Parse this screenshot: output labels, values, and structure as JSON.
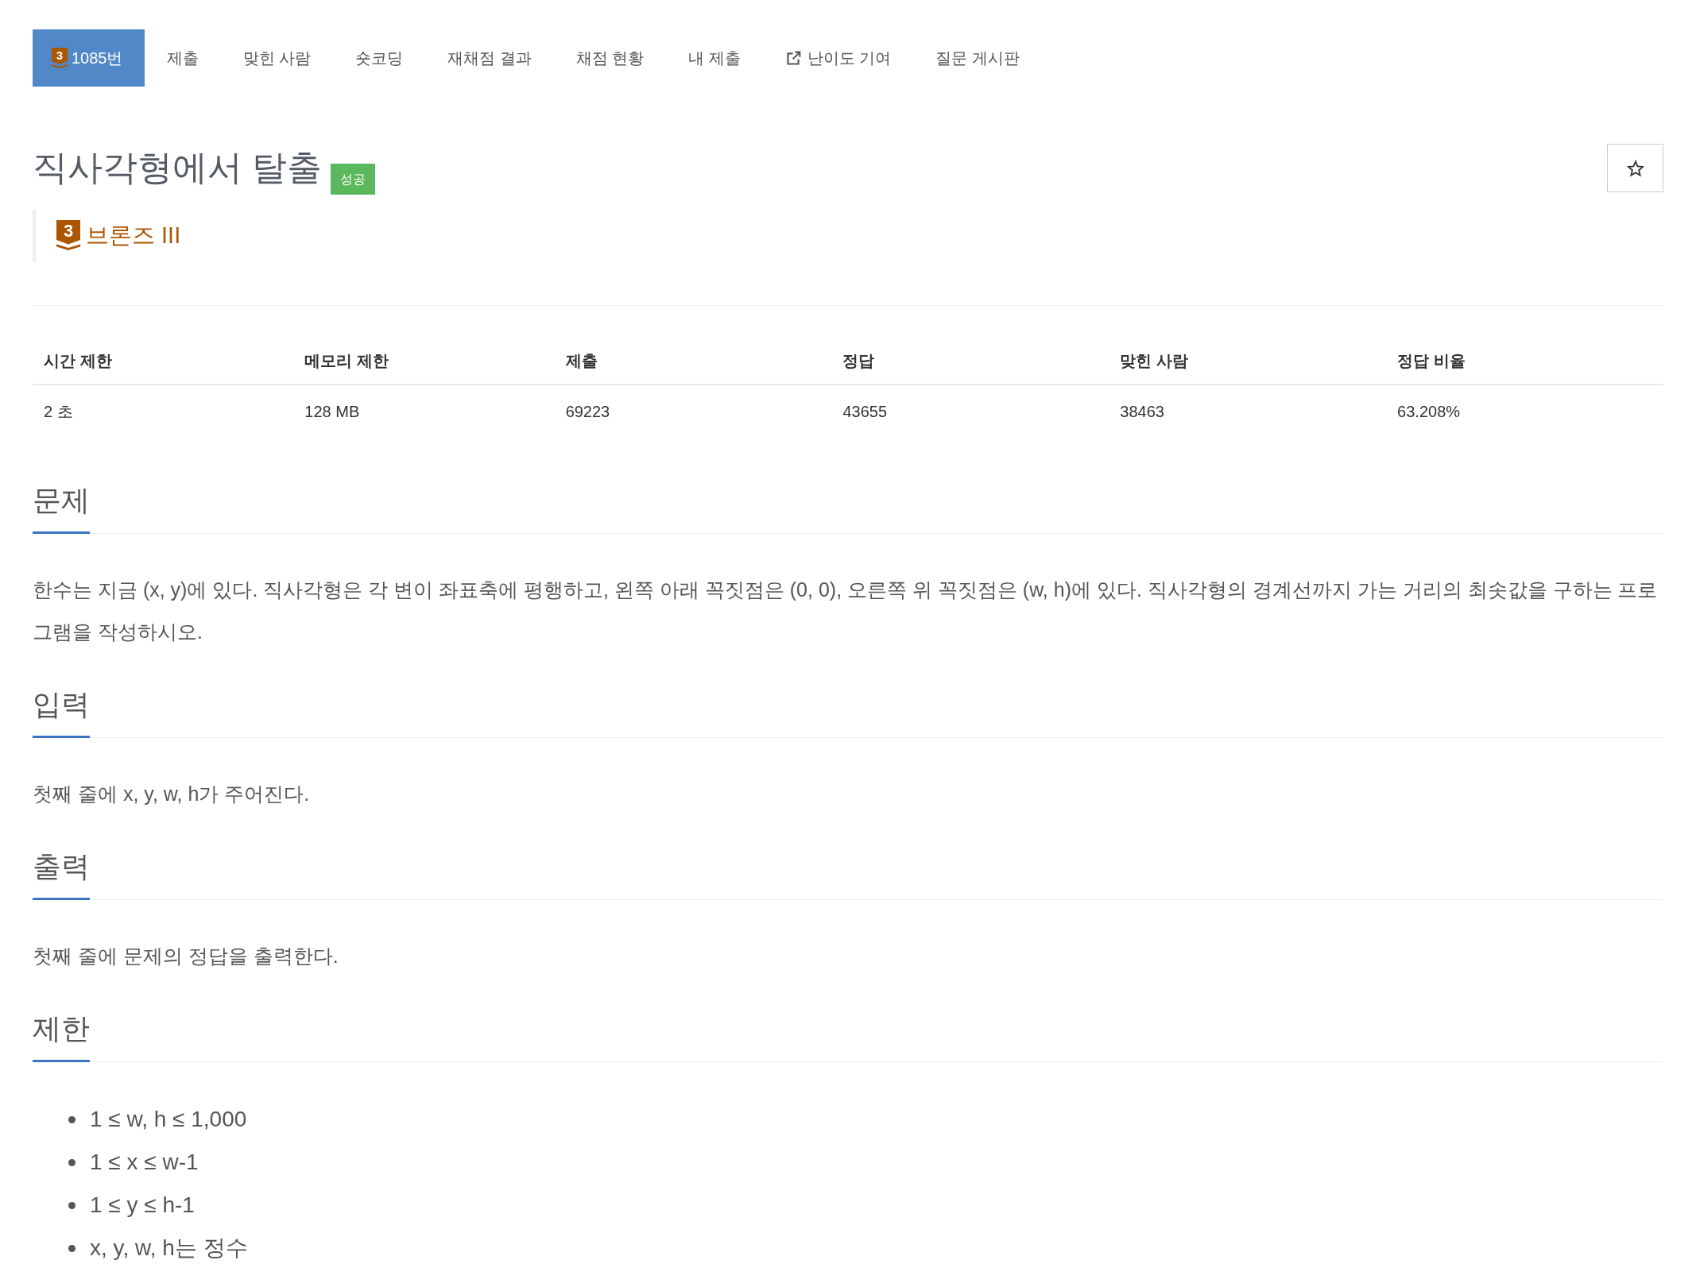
{
  "tabs": [
    {
      "label": "1085번",
      "selected": true,
      "external": false,
      "tier_mark": "3"
    },
    {
      "label": "제출",
      "selected": false,
      "external": false
    },
    {
      "label": "맞힌 사람",
      "selected": false,
      "external": false
    },
    {
      "label": "숏코딩",
      "selected": false,
      "external": false
    },
    {
      "label": "재채점 결과",
      "selected": false,
      "external": false
    },
    {
      "label": "채점 현황",
      "selected": false,
      "external": false
    },
    {
      "label": "내 제출",
      "selected": false,
      "external": false
    },
    {
      "label": "난이도 기여",
      "selected": false,
      "external": true
    },
    {
      "label": "질문 게시판",
      "selected": false,
      "external": false
    }
  ],
  "problem": {
    "title": "직사각형에서 탈출",
    "result_badge": "성공",
    "starred": false,
    "tier": {
      "mark": "3",
      "name": "브론즈 III"
    }
  },
  "stats": {
    "columns": [
      "시간 제한",
      "메모리 제한",
      "제출",
      "정답",
      "맞힌 사람",
      "정답 비율"
    ],
    "rows": [
      [
        "2 초",
        "128 MB",
        "69223",
        "43655",
        "38463",
        "63.208%"
      ]
    ]
  },
  "sections": [
    {
      "kind": "text",
      "heading": "문제",
      "paragraphs": [
        "한수는 지금 (x, y)에 있다. 직사각형은 각 변이 좌표축에 평행하고, 왼쪽 아래 꼭짓점은 (0, 0), 오른쪽 위 꼭짓점은 (w, h)에 있다. 직사각형의 경계선까지 가는 거리의 최솟값을 구하는 프로그램을 작성하시오."
      ]
    },
    {
      "kind": "text",
      "heading": "입력",
      "paragraphs": [
        "첫째 줄에 x, y, w, h가 주어진다."
      ]
    },
    {
      "kind": "text",
      "heading": "출력",
      "paragraphs": [
        "첫째 줄에 문제의 정답을 출력한다."
      ]
    },
    {
      "kind": "list",
      "heading": "제한",
      "items": [
        "1 ≤ w, h ≤ 1,000",
        "1 ≤ x ≤ w-1",
        "1 ≤ y ≤ h-1",
        "x, y, w, h는 정수"
      ]
    }
  ]
}
